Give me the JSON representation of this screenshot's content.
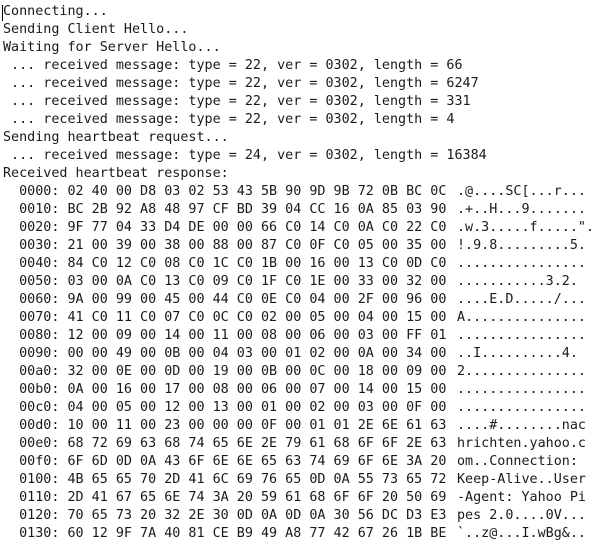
{
  "terminal": {
    "colors": {
      "background": "#ffffff",
      "text": "#1a1a1a"
    },
    "status_lines": [
      "Connecting...",
      "Sending Client Hello...",
      "Waiting for Server Hello...",
      " ... received message: type = 22, ver = 0302, length = 66",
      " ... received message: type = 22, ver = 0302, length = 6247",
      " ... received message: type = 22, ver = 0302, length = 331",
      " ... received message: type = 22, ver = 0302, length = 4",
      "Sending heartbeat request...",
      " ... received message: type = 24, ver = 0302, length = 16384",
      "Received heartbeat response:"
    ],
    "hexdump": [
      {
        "hex": "  0000: 02 40 00 D8 03 02 53 43 5B 90 9D 9B 72 0B BC 0C",
        "ascii": ".@....SC[...r..."
      },
      {
        "hex": "  0010: BC 2B 92 A8 48 97 CF BD 39 04 CC 16 0A 85 03 90",
        "ascii": ".+..H...9......."
      },
      {
        "hex": "  0020: 9F 77 04 33 D4 DE 00 00 66 C0 14 C0 0A C0 22 C0",
        "ascii": ".w.3.....f.....\"."
      },
      {
        "hex": "  0030: 21 00 39 00 38 00 88 00 87 C0 0F C0 05 00 35 00",
        "ascii": "!.9.8.........5."
      },
      {
        "hex": "  0040: 84 C0 12 C0 08 C0 1C C0 1B 00 16 00 13 C0 0D C0",
        "ascii": "................"
      },
      {
        "hex": "  0050: 03 00 0A C0 13 C0 09 C0 1F C0 1E 00 33 00 32 00",
        "ascii": "...........3.2."
      },
      {
        "hex": "  0060: 9A 00 99 00 45 00 44 C0 0E C0 04 00 2F 00 96 00",
        "ascii": "....E.D...../..."
      },
      {
        "hex": "  0070: 41 C0 11 C0 07 C0 0C C0 02 00 05 00 04 00 15 00",
        "ascii": "A..............."
      },
      {
        "hex": "  0080: 12 00 09 00 14 00 11 00 08 00 06 00 03 00 FF 01",
        "ascii": "................"
      },
      {
        "hex": "  0090: 00 00 49 00 0B 00 04 03 00 01 02 00 0A 00 34 00",
        "ascii": "..I..........4."
      },
      {
        "hex": "  00a0: 32 00 0E 00 0D 00 19 00 0B 00 0C 00 18 00 09 00",
        "ascii": "2..............."
      },
      {
        "hex": "  00b0: 0A 00 16 00 17 00 08 00 06 00 07 00 14 00 15 00",
        "ascii": "................"
      },
      {
        "hex": "  00c0: 04 00 05 00 12 00 13 00 01 00 02 00 03 00 0F 00",
        "ascii": "................"
      },
      {
        "hex": "  00d0: 10 00 11 00 23 00 00 00 0F 00 01 01 2E 6E 61 63",
        "ascii": "....#........nac"
      },
      {
        "hex": "  00e0: 68 72 69 63 68 74 65 6E 2E 79 61 68 6F 6F 2E 63",
        "ascii": "hrichten.yahoo.c"
      },
      {
        "hex": "  00f0: 6F 6D 0D 0A 43 6F 6E 6E 65 63 74 69 6F 6E 3A 20",
        "ascii": "om..Connection: "
      },
      {
        "hex": "  0100: 4B 65 65 70 2D 41 6C 69 76 65 0D 0A 55 73 65 72",
        "ascii": "Keep-Alive..User"
      },
      {
        "hex": "  0110: 2D 41 67 65 6E 74 3A 20 59 61 68 6F 6F 20 50 69",
        "ascii": "-Agent: Yahoo Pi"
      },
      {
        "hex": "  0120: 70 65 73 20 32 2E 30 0D 0A 0D 0A 30 56 DC D3 E3",
        "ascii": "pes 2.0....0V..."
      },
      {
        "hex": "  0130: 60 12 9F 7A 40 81 CE B9 49 A8 77 42 67 26 1B BE",
        "ascii": "`..z@...I.wBg&.."
      }
    ]
  }
}
